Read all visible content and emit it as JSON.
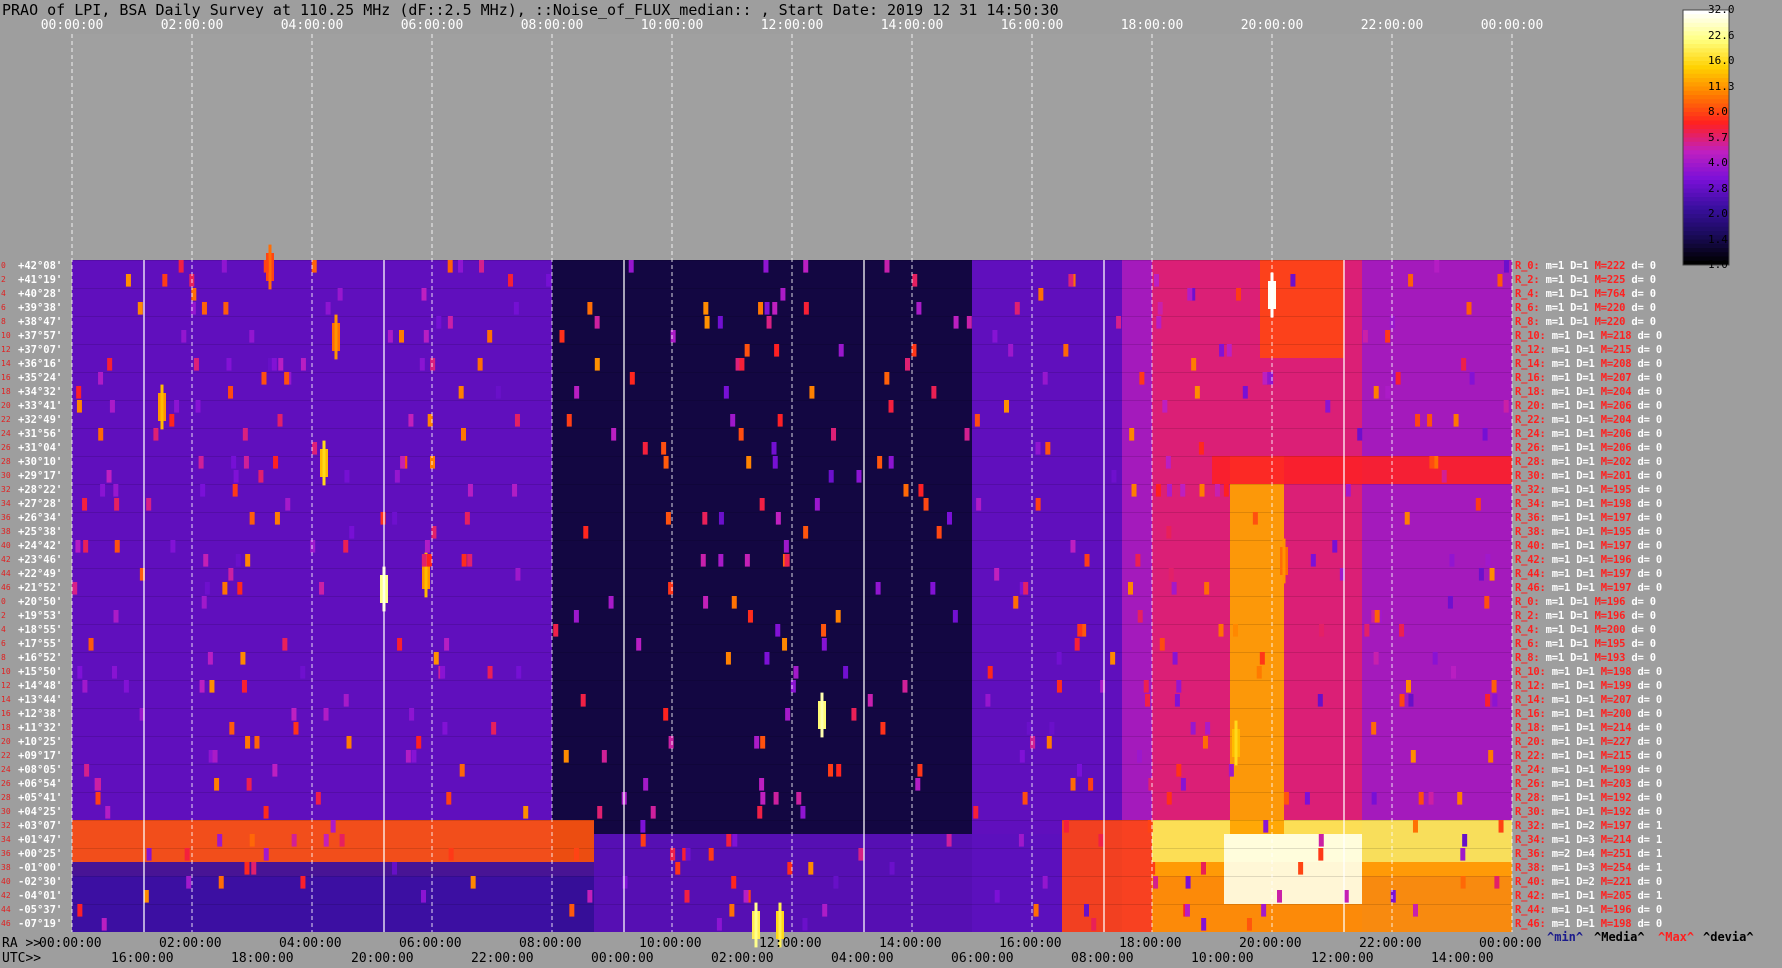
{
  "title": "PRAO of LPI, BSA Daily Survey at 110.25 MHz (dF::2.5 MHz), ::Noise_of_FLUX_median:: , Start Date: 2019 12 31 14:50:30",
  "top_axis_ticks": [
    "00:00:00",
    "02:00:00",
    "04:00:00",
    "06:00:00",
    "08:00:00",
    "10:00:00",
    "12:00:00",
    "14:00:00",
    "16:00:00",
    "18:00:00",
    "20:00:00",
    "22:00:00",
    "00:00:00"
  ],
  "ra_axis": {
    "label": "RA >>",
    "ticks": [
      "00:00:00",
      "02:00:00",
      "04:00:00",
      "06:00:00",
      "08:00:00",
      "10:00:00",
      "12:00:00",
      "14:00:00",
      "16:00:00",
      "18:00:00",
      "20:00:00",
      "22:00:00",
      "00:00:00"
    ]
  },
  "utc_axis": {
    "label": "UTC>>",
    "ticks": [
      "16:00:00",
      "18:00:00",
      "20:00:00",
      "22:00:00",
      "00:00:00",
      "02:00:00",
      "04:00:00",
      "06:00:00",
      "08:00:00",
      "10:00:00",
      "12:00:00",
      "14:00:00"
    ]
  },
  "colorbar": {
    "ticks": [
      "32.0",
      "22.6",
      "16.0",
      "11.3",
      "8.0",
      "5.7",
      "4.0",
      "2.8",
      "2.0",
      "1.4",
      "1.0"
    ]
  },
  "declinations": [
    "+42°08'",
    "+41°19'",
    "+40°28'",
    "+39°38'",
    "+38°47'",
    "+37°57'",
    "+37°07'",
    "+36°16'",
    "+35°24'",
    "+34°32'",
    "+33°41'",
    "+32°49'",
    "+31°56'",
    "+31°04'",
    "+30°10'",
    "+29°17'",
    "+28°22'",
    "+27°28'",
    "+26°34'",
    "+25°38'",
    "+24°42'",
    "+23°46'",
    "+22°49'",
    "+21°52'",
    "+20°50'",
    "+19°53'",
    "+18°55'",
    "+17°55'",
    "+16°52'",
    "+15°50'",
    "+14°48'",
    "+13°44'",
    "+12°38'",
    "+11°32'",
    "+10°25'",
    "+09°17'",
    "+08°05'",
    "+06°54'",
    "+05°41'",
    "+04°25'",
    "+03°07'",
    "+01°47'",
    "+00°25'",
    "-01°00'",
    "-02°30'",
    "-04°01'",
    "-05°37'",
    "-07°19'"
  ],
  "row_numbers": [
    "0",
    "2",
    "4",
    "6",
    "8",
    "10",
    "12",
    "14",
    "16",
    "18",
    "20",
    "22",
    "24",
    "26",
    "28",
    "30",
    "32",
    "34",
    "36",
    "38",
    "40",
    "42",
    "44",
    "46",
    "0",
    "2",
    "4",
    "6",
    "8",
    "10",
    "12",
    "14",
    "16",
    "18",
    "20",
    "22",
    "24",
    "26",
    "28",
    "30",
    "32",
    "34",
    "36",
    "38",
    "40",
    "42",
    "44",
    "46"
  ],
  "stats": [
    {
      "r": "R_0:",
      "m": "m=1",
      "D": "D=1",
      "M": "M=222",
      "d": "d= 0"
    },
    {
      "r": "R_2:",
      "m": "m=1",
      "D": "D=1",
      "M": "M=225",
      "d": "d= 0"
    },
    {
      "r": "R_4:",
      "m": "m=1",
      "D": "D=1",
      "M": "M=764",
      "d": "d= 0"
    },
    {
      "r": "R_6:",
      "m": "m=1",
      "D": "D=1",
      "M": "M=220",
      "d": "d= 0"
    },
    {
      "r": "R_8:",
      "m": "m=1",
      "D": "D=1",
      "M": "M=220",
      "d": "d= 0"
    },
    {
      "r": "R_10:",
      "m": "m=1",
      "D": "D=1",
      "M": "M=218",
      "d": "d= 0"
    },
    {
      "r": "R_12:",
      "m": "m=1",
      "D": "D=1",
      "M": "M=215",
      "d": "d= 0"
    },
    {
      "r": "R_14:",
      "m": "m=1",
      "D": "D=1",
      "M": "M=208",
      "d": "d= 0"
    },
    {
      "r": "R_16:",
      "m": "m=1",
      "D": "D=1",
      "M": "M=207",
      "d": "d= 0"
    },
    {
      "r": "R_18:",
      "m": "m=1",
      "D": "D=1",
      "M": "M=204",
      "d": "d= 0"
    },
    {
      "r": "R_20:",
      "m": "m=1",
      "D": "D=1",
      "M": "M=206",
      "d": "d= 0"
    },
    {
      "r": "R_22:",
      "m": "m=1",
      "D": "D=1",
      "M": "M=204",
      "d": "d= 0"
    },
    {
      "r": "R_24:",
      "m": "m=1",
      "D": "D=1",
      "M": "M=206",
      "d": "d= 0"
    },
    {
      "r": "R_26:",
      "m": "m=1",
      "D": "D=1",
      "M": "M=206",
      "d": "d= 0"
    },
    {
      "r": "R_28:",
      "m": "m=1",
      "D": "D=1",
      "M": "M=202",
      "d": "d= 0"
    },
    {
      "r": "R_30:",
      "m": "m=1",
      "D": "D=1",
      "M": "M=201",
      "d": "d= 0"
    },
    {
      "r": "R_32:",
      "m": "m=1",
      "D": "D=1",
      "M": "M=195",
      "d": "d= 0"
    },
    {
      "r": "R_34:",
      "m": "m=1",
      "D": "D=1",
      "M": "M=198",
      "d": "d= 0"
    },
    {
      "r": "R_36:",
      "m": "m=1",
      "D": "D=1",
      "M": "M=197",
      "d": "d= 0"
    },
    {
      "r": "R_38:",
      "m": "m=1",
      "D": "D=1",
      "M": "M=195",
      "d": "d= 0"
    },
    {
      "r": "R_40:",
      "m": "m=1",
      "D": "D=1",
      "M": "M=197",
      "d": "d= 0"
    },
    {
      "r": "R_42:",
      "m": "m=1",
      "D": "D=1",
      "M": "M=196",
      "d": "d= 0"
    },
    {
      "r": "R_44:",
      "m": "m=1",
      "D": "D=1",
      "M": "M=197",
      "d": "d= 0"
    },
    {
      "r": "R_46:",
      "m": "m=1",
      "D": "D=1",
      "M": "M=197",
      "d": "d= 0"
    },
    {
      "r": "R_0:",
      "m": "m=1",
      "D": "D=1",
      "M": "M=196",
      "d": "d= 0"
    },
    {
      "r": "R_2:",
      "m": "m=1",
      "D": "D=1",
      "M": "M=196",
      "d": "d= 0"
    },
    {
      "r": "R_4:",
      "m": "m=1",
      "D": "D=1",
      "M": "M=200",
      "d": "d= 0"
    },
    {
      "r": "R_6:",
      "m": "m=1",
      "D": "D=1",
      "M": "M=195",
      "d": "d= 0"
    },
    {
      "r": "R_8:",
      "m": "m=1",
      "D": "D=1",
      "M": "M=193",
      "d": "d= 0"
    },
    {
      "r": "R_10:",
      "m": "m=1",
      "D": "D=1",
      "M": "M=198",
      "d": "d= 0"
    },
    {
      "r": "R_12:",
      "m": "m=1",
      "D": "D=1",
      "M": "M=199",
      "d": "d= 0"
    },
    {
      "r": "R_14:",
      "m": "m=1",
      "D": "D=1",
      "M": "M=207",
      "d": "d= 0"
    },
    {
      "r": "R_16:",
      "m": "m=1",
      "D": "D=1",
      "M": "M=200",
      "d": "d= 0"
    },
    {
      "r": "R_18:",
      "m": "m=1",
      "D": "D=1",
      "M": "M=214",
      "d": "d= 0"
    },
    {
      "r": "R_20:",
      "m": "m=1",
      "D": "D=1",
      "M": "M=227",
      "d": "d= 0"
    },
    {
      "r": "R_22:",
      "m": "m=1",
      "D": "D=1",
      "M": "M=215",
      "d": "d= 0"
    },
    {
      "r": "R_24:",
      "m": "m=1",
      "D": "D=1",
      "M": "M=199",
      "d": "d= 0"
    },
    {
      "r": "R_26:",
      "m": "m=1",
      "D": "D=1",
      "M": "M=203",
      "d": "d= 0"
    },
    {
      "r": "R_28:",
      "m": "m=1",
      "D": "D=1",
      "M": "M=192",
      "d": "d= 0"
    },
    {
      "r": "R_30:",
      "m": "m=1",
      "D": "D=1",
      "M": "M=192",
      "d": "d= 0"
    },
    {
      "r": "R_32:",
      "m": "m=1",
      "D": "D=2",
      "M": "M=197",
      "d": "d= 1"
    },
    {
      "r": "R_34:",
      "m": "m=1",
      "D": "D=3",
      "M": "M=214",
      "d": "d= 1"
    },
    {
      "r": "R_36:",
      "m": "m=2",
      "D": "D=4",
      "M": "M=251",
      "d": "d= 1"
    },
    {
      "r": "R_38:",
      "m": "m=1",
      "D": "D=3",
      "M": "M=254",
      "d": "d= 1"
    },
    {
      "r": "R_40:",
      "m": "m=1",
      "D": "D=2",
      "M": "M=221",
      "d": "d= 0"
    },
    {
      "r": "R_42:",
      "m": "m=1",
      "D": "D=1",
      "M": "M=205",
      "d": "d= 1"
    },
    {
      "r": "R_44:",
      "m": "m=1",
      "D": "D=1",
      "M": "M=196",
      "d": "d= 0"
    },
    {
      "r": "R_46:",
      "m": "m=1",
      "D": "D=1",
      "M": "M=198",
      "d": "d= 0"
    }
  ],
  "legend": {
    "min": "^min^",
    "median": "^Media^",
    "max": "^Max^",
    "deviation": "^devia^"
  },
  "colors": {
    "background": "#9e9e9e",
    "max_label": "#ff2020",
    "min_label": "#1a1a8c"
  },
  "chart_data": {
    "type": "heatmap",
    "title": "PRAO of LPI, BSA Daily Survey at 110.25 MHz (dF::2.5 MHz), ::Noise_of_FLUX_median:: , Start Date: 2019 12 31 14:50:30",
    "x_axis": "RA 00:00:00 to 00:00:00 (24 h)",
    "rows": 48,
    "colorscale": [
      "#000000",
      "#1a0b5a",
      "#3b0fa0",
      "#7a10d8",
      "#c020c0",
      "#ff2020",
      "#ff7a00",
      "#ffd000",
      "#ffff80",
      "#ffffff"
    ],
    "colorbar_range": [
      1.0,
      32.0
    ],
    "regions": [
      {
        "ra_start": 0.0,
        "ra_end": 8.0,
        "row_start": 0,
        "row_end": 47,
        "level": 0.3
      },
      {
        "ra_start": 8.0,
        "ra_end": 15.0,
        "row_start": 0,
        "row_end": 47,
        "level": 0.08
      },
      {
        "ra_start": 15.0,
        "ra_end": 17.5,
        "row_start": 0,
        "row_end": 47,
        "level": 0.3
      },
      {
        "ra_start": 17.5,
        "ra_end": 24.0,
        "row_start": 0,
        "row_end": 47,
        "level": 0.42
      },
      {
        "ra_start": 18.0,
        "ra_end": 21.5,
        "row_start": 0,
        "row_end": 47,
        "level": 0.5
      },
      {
        "ra_start": 0.0,
        "ra_end": 8.7,
        "row_start": 40,
        "row_end": 43,
        "level": 0.62
      },
      {
        "ra_start": 0.0,
        "ra_end": 8.7,
        "row_start": 43,
        "row_end": 47,
        "level": 0.22
      },
      {
        "ra_start": 8.7,
        "ra_end": 16.5,
        "row_start": 41,
        "row_end": 47,
        "level": 0.28
      },
      {
        "ra_start": 16.5,
        "ra_end": 18.0,
        "row_start": 40,
        "row_end": 47,
        "level": 0.6
      },
      {
        "ra_start": 18.0,
        "ra_end": 24.0,
        "row_start": 40,
        "row_end": 43,
        "level": 0.85
      },
      {
        "ra_start": 18.0,
        "ra_end": 24.0,
        "row_start": 43,
        "row_end": 47,
        "level": 0.7
      },
      {
        "ra_start": 19.2,
        "ra_end": 21.5,
        "row_start": 41,
        "row_end": 45,
        "level": 0.98
      },
      {
        "ra_start": 19.3,
        "ra_end": 20.2,
        "row_start": 14,
        "row_end": 40,
        "level": 0.72
      },
      {
        "ra_start": 19.0,
        "ra_end": 24.0,
        "row_start": 14,
        "row_end": 15,
        "level": 0.55
      },
      {
        "ra_start": 19.8,
        "ra_end": 21.2,
        "row_start": 0,
        "row_end": 6,
        "level": 0.6
      }
    ],
    "point_sources": [
      {
        "ra": 20.0,
        "row": 2,
        "level": 0.99
      },
      {
        "ra": 5.2,
        "row": 23,
        "level": 0.9
      },
      {
        "ra": 12.5,
        "row": 32,
        "level": 0.88
      },
      {
        "ra": 4.2,
        "row": 14,
        "level": 0.75
      },
      {
        "ra": 1.5,
        "row": 10,
        "level": 0.7
      },
      {
        "ra": 5.9,
        "row": 22,
        "level": 0.7
      },
      {
        "ra": 11.4,
        "row": 47,
        "level": 0.85
      },
      {
        "ra": 11.8,
        "row": 47,
        "level": 0.8
      },
      {
        "ra": 19.4,
        "row": 34,
        "level": 0.75
      },
      {
        "ra": 20.2,
        "row": 21,
        "level": 0.65
      },
      {
        "ra": 3.3,
        "row": 0,
        "level": 0.6
      },
      {
        "ra": 4.4,
        "row": 5,
        "level": 0.65
      }
    ]
  }
}
